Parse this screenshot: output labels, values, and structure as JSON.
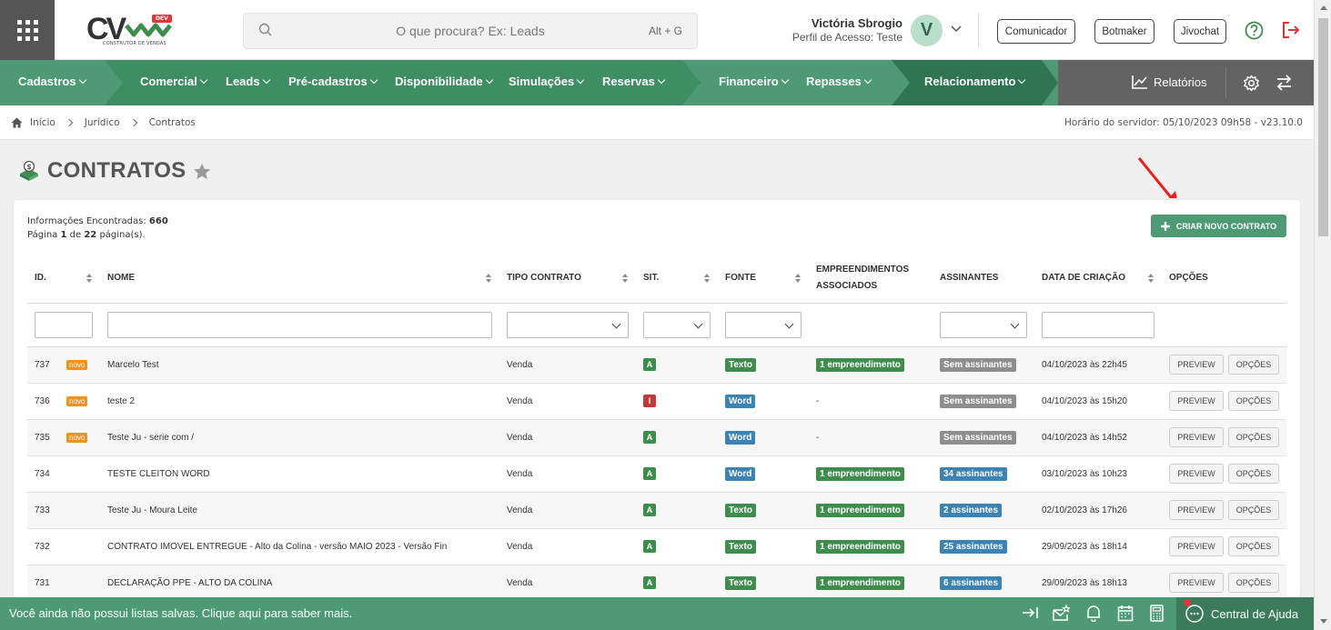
{
  "header": {
    "logo_text": "CV",
    "logo_badge": "DEV",
    "logo_sub": "CONSTRUTOR DE VENDAS",
    "search_placeholder": "O que procura? Ex: Leads",
    "search_shortcut": "Alt + G",
    "user_name": "Victória Sbrogio",
    "user_profile": "Perfil de Acesso: Teste",
    "avatar_initial": "V",
    "buttons": [
      "Comunicador",
      "Botmaker",
      "Jivochat"
    ]
  },
  "nav": {
    "items": [
      "Cadastros",
      "Comercial",
      "Leads",
      "Pré-cadastros",
      "Disponibilidade",
      "Simulações",
      "Reservas",
      "Financeiro",
      "Repasses",
      "Relacionamento"
    ],
    "reports": "Relatórios"
  },
  "breadcrumb": [
    "Início",
    "Jurídico",
    "Contratos"
  ],
  "server_time": "Horário do servidor: 05/10/2023 09h58 - v23.10.0",
  "page": {
    "title": "CONTRATOS",
    "info_label": "Informações Encontradas:",
    "info_count": "660",
    "page_label": "Página",
    "page_current": "1",
    "page_of": "de",
    "page_total": "22",
    "page_suffix": "página(s).",
    "create_button": "CRIAR NOVO CONTRATO"
  },
  "table": {
    "columns": [
      "ID.",
      "NOME",
      "TIPO CONTRATO",
      "SIT.",
      "FONTE",
      "EMPREENDIMENTOS ASSOCIADOS",
      "ASSINANTES",
      "DATA DE CRIAÇÃO",
      "OPÇÕES"
    ],
    "rows": [
      {
        "id": "737",
        "novo": "novo",
        "name": "Marcelo Test",
        "type": "Venda",
        "sit": "A",
        "fonte": "Texto",
        "emp": "1 empreendimento",
        "assin": "Sem assinantes",
        "date": "04/10/2023 às 22h45"
      },
      {
        "id": "736",
        "novo": "novo",
        "name": "teste 2",
        "type": "Venda",
        "sit": "I",
        "fonte": "Word",
        "emp": "-",
        "assin": "Sem assinantes",
        "date": "04/10/2023 às 15h20"
      },
      {
        "id": "735",
        "novo": "novo",
        "name": "Teste Ju - serie com /",
        "type": "Venda",
        "sit": "A",
        "fonte": "Word",
        "emp": "-",
        "assin": "Sem assinantes",
        "date": "04/10/2023 às 14h52"
      },
      {
        "id": "734",
        "novo": "",
        "name": "TESTE CLEITON WORD",
        "type": "Venda",
        "sit": "A",
        "fonte": "Word",
        "emp": "1 empreendimento",
        "assin": "34 assinantes",
        "date": "03/10/2023 às 10h23"
      },
      {
        "id": "733",
        "novo": "",
        "name": "Teste Ju - Moura Leite",
        "type": "Venda",
        "sit": "A",
        "fonte": "Texto",
        "emp": "1 empreendimento",
        "assin": "2 assinantes",
        "date": "02/10/2023 às 17h26"
      },
      {
        "id": "732",
        "novo": "",
        "name": "CONTRATO IMOVEL ENTREGUE - Alto da Colina - versão MAIO 2023 - Versão Fin",
        "type": "Venda",
        "sit": "A",
        "fonte": "Texto",
        "emp": "1 empreendimento",
        "assin": "25 assinantes",
        "date": "29/09/2023 às 18h14"
      },
      {
        "id": "731",
        "novo": "",
        "name": "DECLARAÇÃO PPE - ALTO DA COLINA",
        "type": "Venda",
        "sit": "A",
        "fonte": "Texto",
        "emp": "1 empreendimento",
        "assin": "6 assinantes",
        "date": "29/09/2023 às 18h13"
      }
    ],
    "preview_label": "PREVIEW",
    "options_label": "OPÇÕES"
  },
  "bottom": {
    "message": "Você ainda não possui listas salvas. Clique aqui para saber mais.",
    "help_center": "Central de Ajuda"
  },
  "colors": {
    "green": "#4e9a74",
    "dark_green": "#3b7a5a",
    "sit_active": "#3f8d4e",
    "sit_inactive": "#c0393b",
    "texto": "#3f8d4e",
    "word": "#3b82b5",
    "emp": "#3f8d4e",
    "no_signers": "#8e8e8e",
    "signers": "#3b82b5",
    "novo": "#f0941e"
  }
}
